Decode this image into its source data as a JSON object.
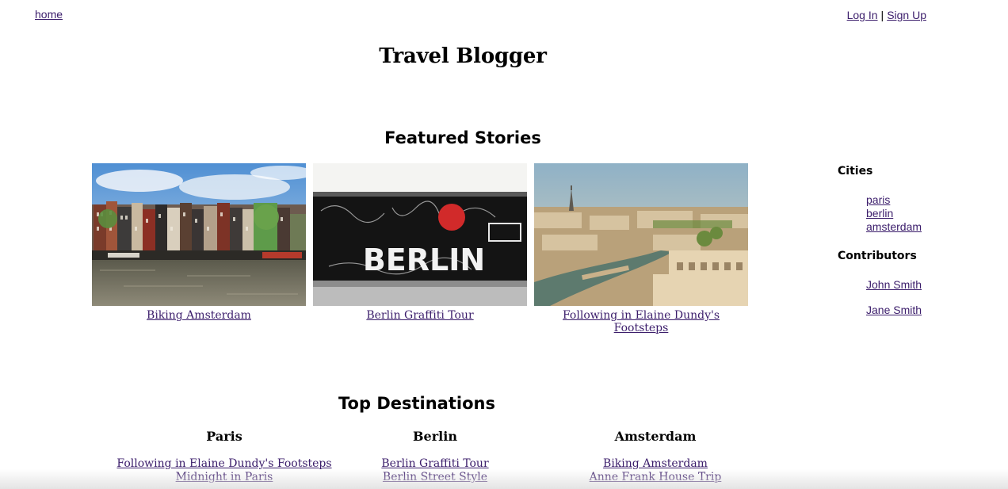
{
  "nav": {
    "home": "home",
    "login": "Log In",
    "separator": "|",
    "signup": "Sign Up"
  },
  "site_title": "Travel Blogger",
  "featured": {
    "title": "Featured Stories",
    "stories": [
      {
        "label": "Biking Amsterdam",
        "image": "amsterdam-canal-houses-photo"
      },
      {
        "label": "Berlin Graffiti Tour",
        "image": "berlin-wall-graffiti-photo"
      },
      {
        "label": "Following in Elaine Dundy's Footsteps",
        "image": "paris-aerial-view-photo"
      }
    ]
  },
  "sidebar": {
    "cities_heading": "Cities",
    "cities": [
      "paris",
      "berlin",
      "amsterdam"
    ],
    "contributors_heading": "Contributors",
    "contributors": [
      "John Smith",
      "Jane Smith"
    ]
  },
  "destinations": {
    "title": "Top Destinations",
    "columns": [
      {
        "city": "Paris",
        "links": [
          "Following in Elaine Dundy's Footsteps",
          "Midnight in Paris"
        ]
      },
      {
        "city": "Berlin",
        "links": [
          "Berlin Graffiti Tour",
          "Berlin Street Style"
        ]
      },
      {
        "city": "Amsterdam",
        "links": [
          "Biking Amsterdam",
          "Anne Frank House Trip"
        ]
      }
    ]
  }
}
